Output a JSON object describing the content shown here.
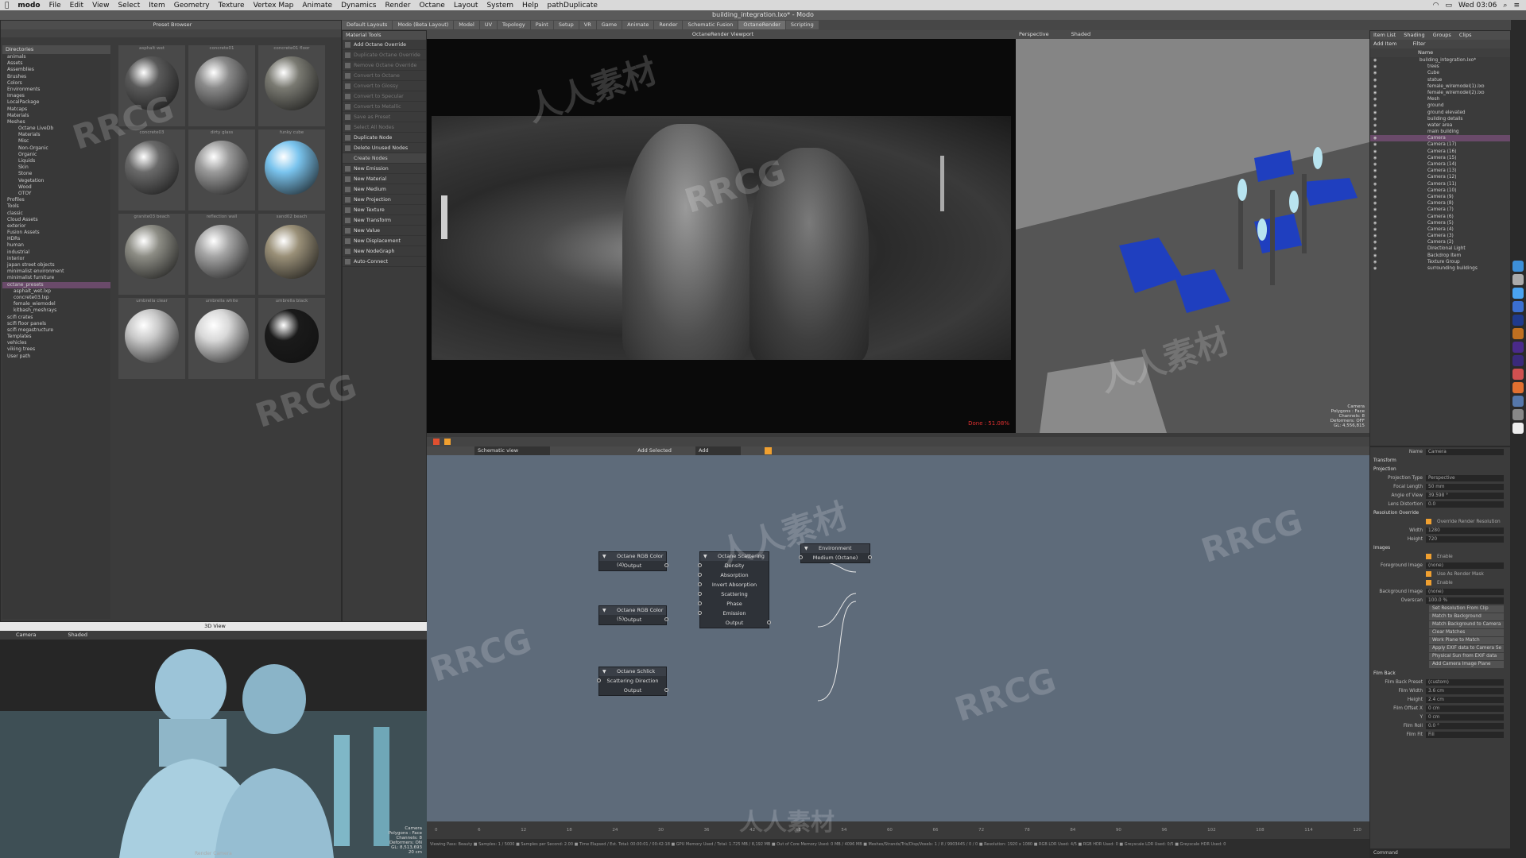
{
  "menubar": {
    "apple": "",
    "app": "modo",
    "items": [
      "File",
      "Edit",
      "View",
      "Select",
      "Item",
      "Geometry",
      "Texture",
      "Vertex Map",
      "Animate",
      "Dynamics",
      "Render",
      "Octane",
      "Layout",
      "System",
      "Help",
      "pathDuplicate"
    ],
    "clock": "Wed 03:06"
  },
  "window_title": "building_integration.lxo* - Modo",
  "layout_tabs": [
    "Default Layouts",
    "Modo (Beta Layout)",
    "Model",
    "UV",
    "Topology",
    "Paint",
    "Setup",
    "VR",
    "Game",
    "Animate",
    "Render",
    "Schematic Fusion",
    "OctaneRender",
    "Scripting"
  ],
  "preset_browser": {
    "title": "Preset Browser",
    "tree_header": "Directories",
    "tree": [
      "animals",
      "Assets",
      "Assemblies",
      "Brushes",
      "Colors",
      "Environments",
      "Images",
      "LocalPackage",
      "Matcaps",
      "Materials",
      "Meshes",
      "Octane LiveDb",
      "Materials",
      "Misc",
      "Non-Organic",
      "Organic",
      "Liquids",
      "Skin",
      "Stone",
      "Vegetation",
      "Wood",
      "OTOY",
      "Profiles",
      "Tools",
      "classic",
      "Cloud Assets",
      "exterior",
      "Fusion Assets",
      "HDRs",
      "human",
      "industrial",
      "interior",
      "japan street objects",
      "minimalist environment",
      "minimalist furniture",
      "octane_presets",
      "asphalt_wet.lxp",
      "concrete03.lxp",
      "female_wiemodel",
      "kitbash_meshrays",
      "scifi crates",
      "scifi floor panels",
      "scifi megastructure",
      "Templates",
      "vehicles",
      "viking trees",
      "User path"
    ],
    "tree_selected_index": 35,
    "materials": [
      {
        "name": "asphalt wet",
        "color": "#5a5a5a"
      },
      {
        "name": "concrete01",
        "color": "#8a8a8a"
      },
      {
        "name": "concrete01 floor",
        "color": "#7a7a72"
      },
      {
        "name": "concrete03",
        "color": "#6a6a6a"
      },
      {
        "name": "dirty glass",
        "color": "#9a9a9a"
      },
      {
        "name": "funky cube",
        "color": "#7ac4ee"
      },
      {
        "name": "granite03 beach",
        "color": "#8d8d85"
      },
      {
        "name": "reflection wall",
        "color": "#a5a5a5"
      },
      {
        "name": "sand02 beach",
        "color": "#9a9078"
      },
      {
        "name": "umbrella clear",
        "color": "#c8c8c8"
      },
      {
        "name": "umbrella white",
        "color": "#d8d8d8"
      },
      {
        "name": "umbrella black",
        "color": "#1a1a1a"
      }
    ]
  },
  "material_tools": {
    "title": "Material Tools",
    "rows": [
      {
        "label": "Add Octane Override",
        "dim": false
      },
      {
        "label": "Duplicate Octane Override",
        "dim": true
      },
      {
        "label": "Remove Octane Override",
        "dim": true
      },
      {
        "label": "Convert to Octane",
        "dim": true
      },
      {
        "label": "Convert to Glossy",
        "dim": true
      },
      {
        "label": "Convert to Specular",
        "dim": true
      },
      {
        "label": "Convert to Metallic",
        "dim": true
      },
      {
        "label": "Save as Preset",
        "dim": true
      },
      {
        "label": "Select All Nodes",
        "dim": true
      },
      {
        "label": "Duplicate Node",
        "dim": false
      },
      {
        "label": "Delete Unused Nodes",
        "dim": false
      },
      {
        "label": "Create Nodes",
        "sep": true
      },
      {
        "label": "New Emission",
        "dim": false
      },
      {
        "label": "New Material",
        "dim": false
      },
      {
        "label": "New Medium",
        "dim": false
      },
      {
        "label": "New Projection",
        "dim": false
      },
      {
        "label": "New Texture",
        "dim": false
      },
      {
        "label": "New Transform",
        "dim": false
      },
      {
        "label": "New Value",
        "dim": false
      },
      {
        "label": "New Displacement",
        "dim": false
      },
      {
        "label": "New NodeGraph",
        "dim": false
      },
      {
        "label": "Auto-Connect",
        "dim": false
      }
    ]
  },
  "render_view": {
    "title": "OctaneRender Viewport",
    "status": "Done : 51.08%"
  },
  "viewport3d": {
    "view": "Perspective",
    "shading": "Shaded",
    "info": [
      "Camera",
      "Polygons : Face",
      "Channels: 8",
      "Deformers: OFF",
      "GL: 4,556,815"
    ]
  },
  "small_view": {
    "header": "3D View",
    "view": "Camera",
    "shading": "Shaded",
    "bottom_label": "Render Camera",
    "info": [
      "Camera",
      "Polygons : Face",
      "Channels: 8",
      "Deformers: ON",
      "GL: 8,513,693",
      "20 cm"
    ]
  },
  "node_editor": {
    "toolbar_menu": "Schematic view",
    "add_selected": "Add Selected",
    "add": "Add",
    "nodes": [
      {
        "title": "Octane RGB Color (4)",
        "ports": [
          "Output"
        ]
      },
      {
        "title": "Octane RGB Color (5)",
        "ports": [
          "Output"
        ]
      },
      {
        "title": "Octane Schlick",
        "ports": [
          "Scattering Direction",
          "Output"
        ]
      },
      {
        "title": "Octane Scattering",
        "ports": [
          "Density",
          "Absorption",
          "Invert Absorption",
          "Scattering",
          "Phase",
          "Emission",
          "Output"
        ]
      },
      {
        "title": "Environment",
        "ports": [
          "Medium (Octane)"
        ]
      }
    ]
  },
  "timeline": {
    "ticks": [
      "0",
      "6",
      "12",
      "18",
      "24",
      "30",
      "36",
      "42",
      "48",
      "54",
      "60",
      "66",
      "72",
      "78",
      "84",
      "90",
      "96",
      "102",
      "108",
      "114",
      "120"
    ]
  },
  "status_bar": "Viewing Pass: Beauty ■ Samples: 1 / 5000 ■ Samples per Second: 2.00 ■ Time Elapsed / Est. Total: 00:00:01 / 00:42:18 ■ GPU Memory Used / Total: 1.725 MB / 8,192 MB ■ Out of Core Memory Used: 0 MB / 4096 MB ■ Meshes/Strands/Tris/Disp/Voxels: 1 / 8 / 9903445 / 0 / 0 ■ Resolution: 1920 x 1080 ■ RGB LDR Used: 4/5 ■ RGB HDR Used: 0 ■ Greyscale LDR Used: 0/5 ■ Greyscale HDR Used: 0",
  "items_panel": {
    "tabs": [
      "Item List",
      "Shading",
      "Groups",
      "Clips"
    ],
    "add_item": "Add Item",
    "filter": "Filter",
    "column": "Name",
    "rows": [
      {
        "label": "building_integration.lxo*",
        "level": 0
      },
      {
        "label": "trees",
        "level": 1
      },
      {
        "label": "Cube",
        "level": 1
      },
      {
        "label": "statue",
        "level": 1
      },
      {
        "label": "female_wiremodel(1).lxo",
        "level": 1
      },
      {
        "label": "female_wiremodel(2).lxo",
        "level": 1
      },
      {
        "label": "Mesh",
        "level": 1
      },
      {
        "label": "ground",
        "level": 1
      },
      {
        "label": "ground elevated",
        "level": 1
      },
      {
        "label": "building details",
        "level": 1
      },
      {
        "label": "water area",
        "level": 1
      },
      {
        "label": "main building",
        "level": 1
      },
      {
        "label": "Camera",
        "level": 1,
        "selected": true
      },
      {
        "label": "Camera (17)",
        "level": 1
      },
      {
        "label": "Camera (16)",
        "level": 1
      },
      {
        "label": "Camera (15)",
        "level": 1
      },
      {
        "label": "Camera (14)",
        "level": 1
      },
      {
        "label": "Camera (13)",
        "level": 1
      },
      {
        "label": "Camera (12)",
        "level": 1
      },
      {
        "label": "Camera (11)",
        "level": 1
      },
      {
        "label": "Camera (10)",
        "level": 1
      },
      {
        "label": "Camera (9)",
        "level": 1
      },
      {
        "label": "Camera (8)",
        "level": 1
      },
      {
        "label": "Camera (7)",
        "level": 1
      },
      {
        "label": "Camera (6)",
        "level": 1
      },
      {
        "label": "Camera (5)",
        "level": 1
      },
      {
        "label": "Camera (4)",
        "level": 1
      },
      {
        "label": "Camera (3)",
        "level": 1
      },
      {
        "label": "Camera (2)",
        "level": 1
      },
      {
        "label": "Directional Light",
        "level": 1
      },
      {
        "label": "Backdrop Item",
        "level": 1
      },
      {
        "label": "Texture Group",
        "level": 1
      },
      {
        "label": "surrounding buildings",
        "level": 1
      }
    ]
  },
  "properties": {
    "name_label": "Name",
    "name_value": "Camera",
    "fields": [
      {
        "type": "sec",
        "label": "Transform"
      },
      {
        "type": "sec",
        "label": "Projection"
      },
      {
        "type": "field",
        "label": "Projection Type",
        "value": "Perspective"
      },
      {
        "type": "field",
        "label": "Focal Length",
        "value": "50 mm"
      },
      {
        "type": "field",
        "label": "Angle of View",
        "value": "39.598 °"
      },
      {
        "type": "field",
        "label": "Lens Distortion",
        "value": "0.0"
      },
      {
        "type": "sec",
        "label": "Resolution Override"
      },
      {
        "type": "check",
        "label": "",
        "value": "Override Render Resolution"
      },
      {
        "type": "field",
        "label": "Width",
        "value": "1280"
      },
      {
        "type": "field",
        "label": "Height",
        "value": "720"
      },
      {
        "type": "sec",
        "label": "Images"
      },
      {
        "type": "check",
        "label": "",
        "value": "Enable"
      },
      {
        "type": "field",
        "label": "Foreground Image",
        "value": "(none)"
      },
      {
        "type": "check",
        "label": "",
        "value": "Use As Render Mask"
      },
      {
        "type": "check",
        "label": "",
        "value": "Enable"
      },
      {
        "type": "field",
        "label": "Background Image",
        "value": "(none)"
      },
      {
        "type": "field",
        "label": "Overscan",
        "value": "100.0 %"
      },
      {
        "type": "btn",
        "label": "Set Resolution From Clip"
      },
      {
        "type": "btn",
        "label": "Match to Background"
      },
      {
        "type": "btn",
        "label": "Match Background to Camera"
      },
      {
        "type": "btn",
        "label": "Clear Matches"
      },
      {
        "type": "btn",
        "label": "Work Plane to Match"
      },
      {
        "type": "btn",
        "label": "Apply EXIF data to Camera Se"
      },
      {
        "type": "btn",
        "label": "Physical Sun from EXIF data"
      },
      {
        "type": "btn",
        "label": "Add Camera Image Plane"
      },
      {
        "type": "sec",
        "label": "Film Back"
      },
      {
        "type": "field",
        "label": "Film Back Preset",
        "value": "(custom)"
      },
      {
        "type": "field",
        "label": "Film Width",
        "value": "3.6 cm"
      },
      {
        "type": "field",
        "label": "Height",
        "value": "2.4 cm"
      },
      {
        "type": "field",
        "label": "Film Offset X",
        "value": "0 cm"
      },
      {
        "type": "field",
        "label": "Y",
        "value": "0 cm"
      },
      {
        "type": "field",
        "label": "Film Roll",
        "value": "0.0 °"
      },
      {
        "type": "field",
        "label": "Film Fit",
        "value": "Fill"
      }
    ],
    "command_label": "Command"
  },
  "watermarks": [
    "RRCG",
    "人人素材"
  ],
  "colors": {
    "accent": "#f0a030",
    "selection": "#6a4a6a",
    "node_bg": "#2e3238",
    "blue": "#1f3fbf"
  }
}
